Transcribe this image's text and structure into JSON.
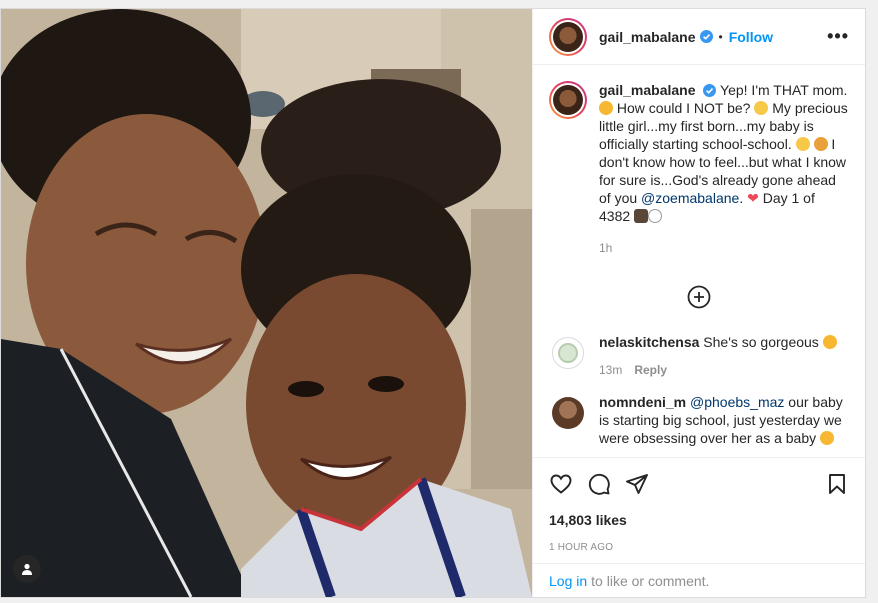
{
  "post": {
    "username": "gail_mabalane",
    "follow_label": "Follow",
    "dot": "•",
    "more_label": "•••",
    "caption": {
      "part1": "Yep! I'm THAT mom. ",
      "part2": " How could I NOT be? ",
      "part3": " My precious little girl...my first born...my baby is officially starting school-school. ",
      "part4": " I don't know how to feel...but what I know for sure is...God's already gone ahead of you ",
      "mention": "@zoemabalane",
      "part5": ". ",
      "part6": " Day 1 of 4382 "
    },
    "caption_time": "1h",
    "comments": [
      {
        "username": "nelaskitchensa",
        "text": "She's so gorgeous",
        "time": "13m",
        "reply_label": "Reply"
      },
      {
        "username": "nomndeni_m",
        "mention": "@phoebs_maz",
        "text": " our baby is starting big school, just yesterday we were obsessing over her as a baby"
      }
    ],
    "likes": "14,803 likes",
    "timestamp": "1 HOUR AGO",
    "login_link": "Log in",
    "login_text": "to like or comment."
  },
  "colors": {
    "accent": "#0095f6",
    "verified": "#3897f0",
    "heart": "#ed4956",
    "text": "#262626",
    "muted": "#8e8e8e"
  },
  "icons": [
    "verified-badge-icon",
    "more-options-icon",
    "load-more-icon",
    "heart-icon",
    "comment-icon",
    "share-icon",
    "bookmark-icon",
    "user-tag-icon"
  ]
}
